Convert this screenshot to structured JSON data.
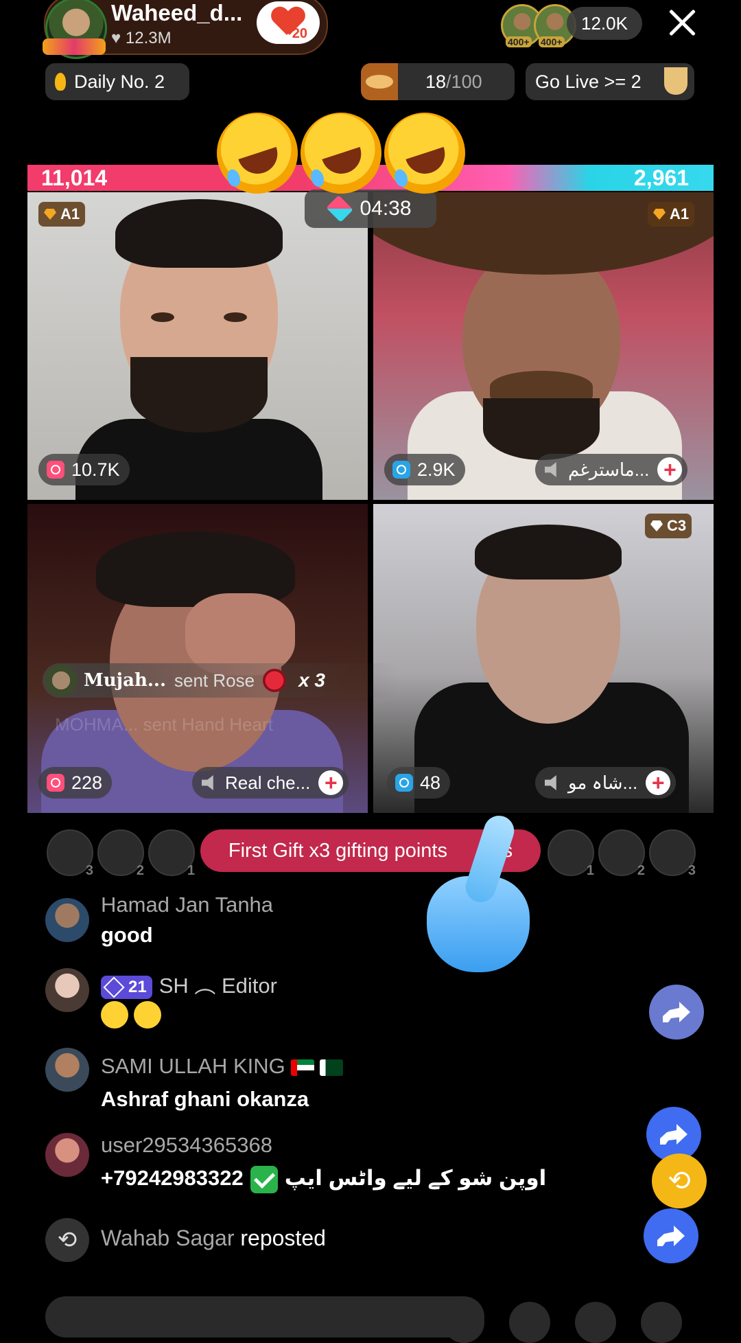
{
  "header": {
    "host_name": "Waheed_d...",
    "host_likes": "12.3M",
    "follow_heart_count": "20",
    "top_viewer_badges": [
      "400+",
      "400+"
    ],
    "viewer_count": "12.0K"
  },
  "chips": {
    "daily": "Daily No. 2",
    "progress_current": "18",
    "progress_total": "/100",
    "go_live": "Go Live >= 2"
  },
  "battle": {
    "left_score": "11,014",
    "right_score": "2,961",
    "timer": "04:38"
  },
  "tiles": [
    {
      "rank": "A1",
      "likes": "10.7K"
    },
    {
      "rank": "A1",
      "likes": "2.9K",
      "name": "ماسترغم..."
    },
    {
      "likes": "228",
      "name": "Real che..."
    },
    {
      "rank": "C3",
      "likes": "48",
      "name": "شاہ مو..."
    }
  ],
  "gift_notice": {
    "name": "Mujah...",
    "action": "sent Rose",
    "count": "x 3",
    "ghost": "MOHMA... sent Hand Heart"
  },
  "first_gift": {
    "text": "First Gift x3 gifting points",
    "countdown": "27s"
  },
  "mini_avatar_ranks": [
    "3",
    "2",
    "1",
    "1",
    "2",
    "3"
  ],
  "comments": [
    {
      "user": "Hamad Jan Tanha",
      "text": "good"
    },
    {
      "level": "21",
      "user": "SH ︵ Editor",
      "text": ""
    },
    {
      "user": "SAMI ULLAH KING",
      "text": "Ashraf ghani okanza"
    },
    {
      "user": "user29534365368",
      "text_a": "+79242983322",
      "text_b": "اوپن شو کے لیے واٹس ایپ"
    }
  ],
  "repost": {
    "user": "Wahab Sagar",
    "action": "reposted"
  },
  "colors": {
    "accent_pink": "#c2294c",
    "battle_left": "#f23c6b",
    "battle_right": "#36d8ee",
    "share_blue": "#3f6cf0"
  }
}
